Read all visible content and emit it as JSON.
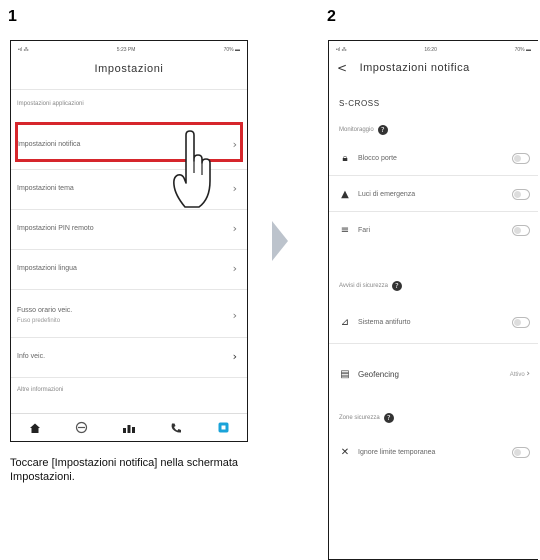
{
  "steps": [
    {
      "number": "1",
      "caption": "Toccare [Impostazioni notifica] nella schermata Impostazioni."
    },
    {
      "number": "2",
      "caption": ""
    }
  ],
  "screen1": {
    "status": {
      "left": "•ıl ⁂",
      "center": "5:23 PM",
      "right": "70% ▬"
    },
    "title": "Impostazioni",
    "section1_label": "Impostazioni applicazioni",
    "items": [
      {
        "label": "Impostazioni notifica",
        "sublabel": ""
      },
      {
        "label": "Impostazioni tema",
        "sublabel": ""
      },
      {
        "label": "Impostazioni PIN remoto",
        "sublabel": ""
      },
      {
        "label": "Impostazioni lingua",
        "sublabel": ""
      },
      {
        "label": "Fusso orario veic.",
        "sublabel": "Fuso predefinito"
      },
      {
        "label": "Info veic.",
        "sublabel": ""
      }
    ],
    "section2_label": "Altre informazioni",
    "tabs": [
      "home-icon",
      "location-icon",
      "stats-icon",
      "phone-icon",
      "settings-icon"
    ]
  },
  "screen2": {
    "status": {
      "left": "•ıl ⁂",
      "center": "16:20",
      "right": "70% ▬"
    },
    "back_label": "<",
    "title": "Impostazioni notifica",
    "vehicle_name": "S-CROSS",
    "section1_label": "Monitoraggio",
    "section1_items": [
      {
        "label": "Blocco porte",
        "icon": "door-lock-icon"
      },
      {
        "label": "Luci di emergenza",
        "icon": "hazard-icon"
      },
      {
        "label": "Fari",
        "icon": "headlight-icon"
      }
    ],
    "section2_label": "Avvisi di sicurezza",
    "section2_items": [
      {
        "label": "Sistema antifurto",
        "icon": "alarm-icon"
      }
    ],
    "geofence": {
      "label": "Geofencing",
      "value": "Attivo"
    },
    "section3_label": "Zone sicurezza",
    "section3_items": [
      {
        "label": "Ignore limite temporanea",
        "icon": "tools-icon"
      }
    ]
  },
  "colors": {
    "highlight": "#d6262c",
    "arrow": "#bcc3cc",
    "accent": "#1aa3d9"
  }
}
